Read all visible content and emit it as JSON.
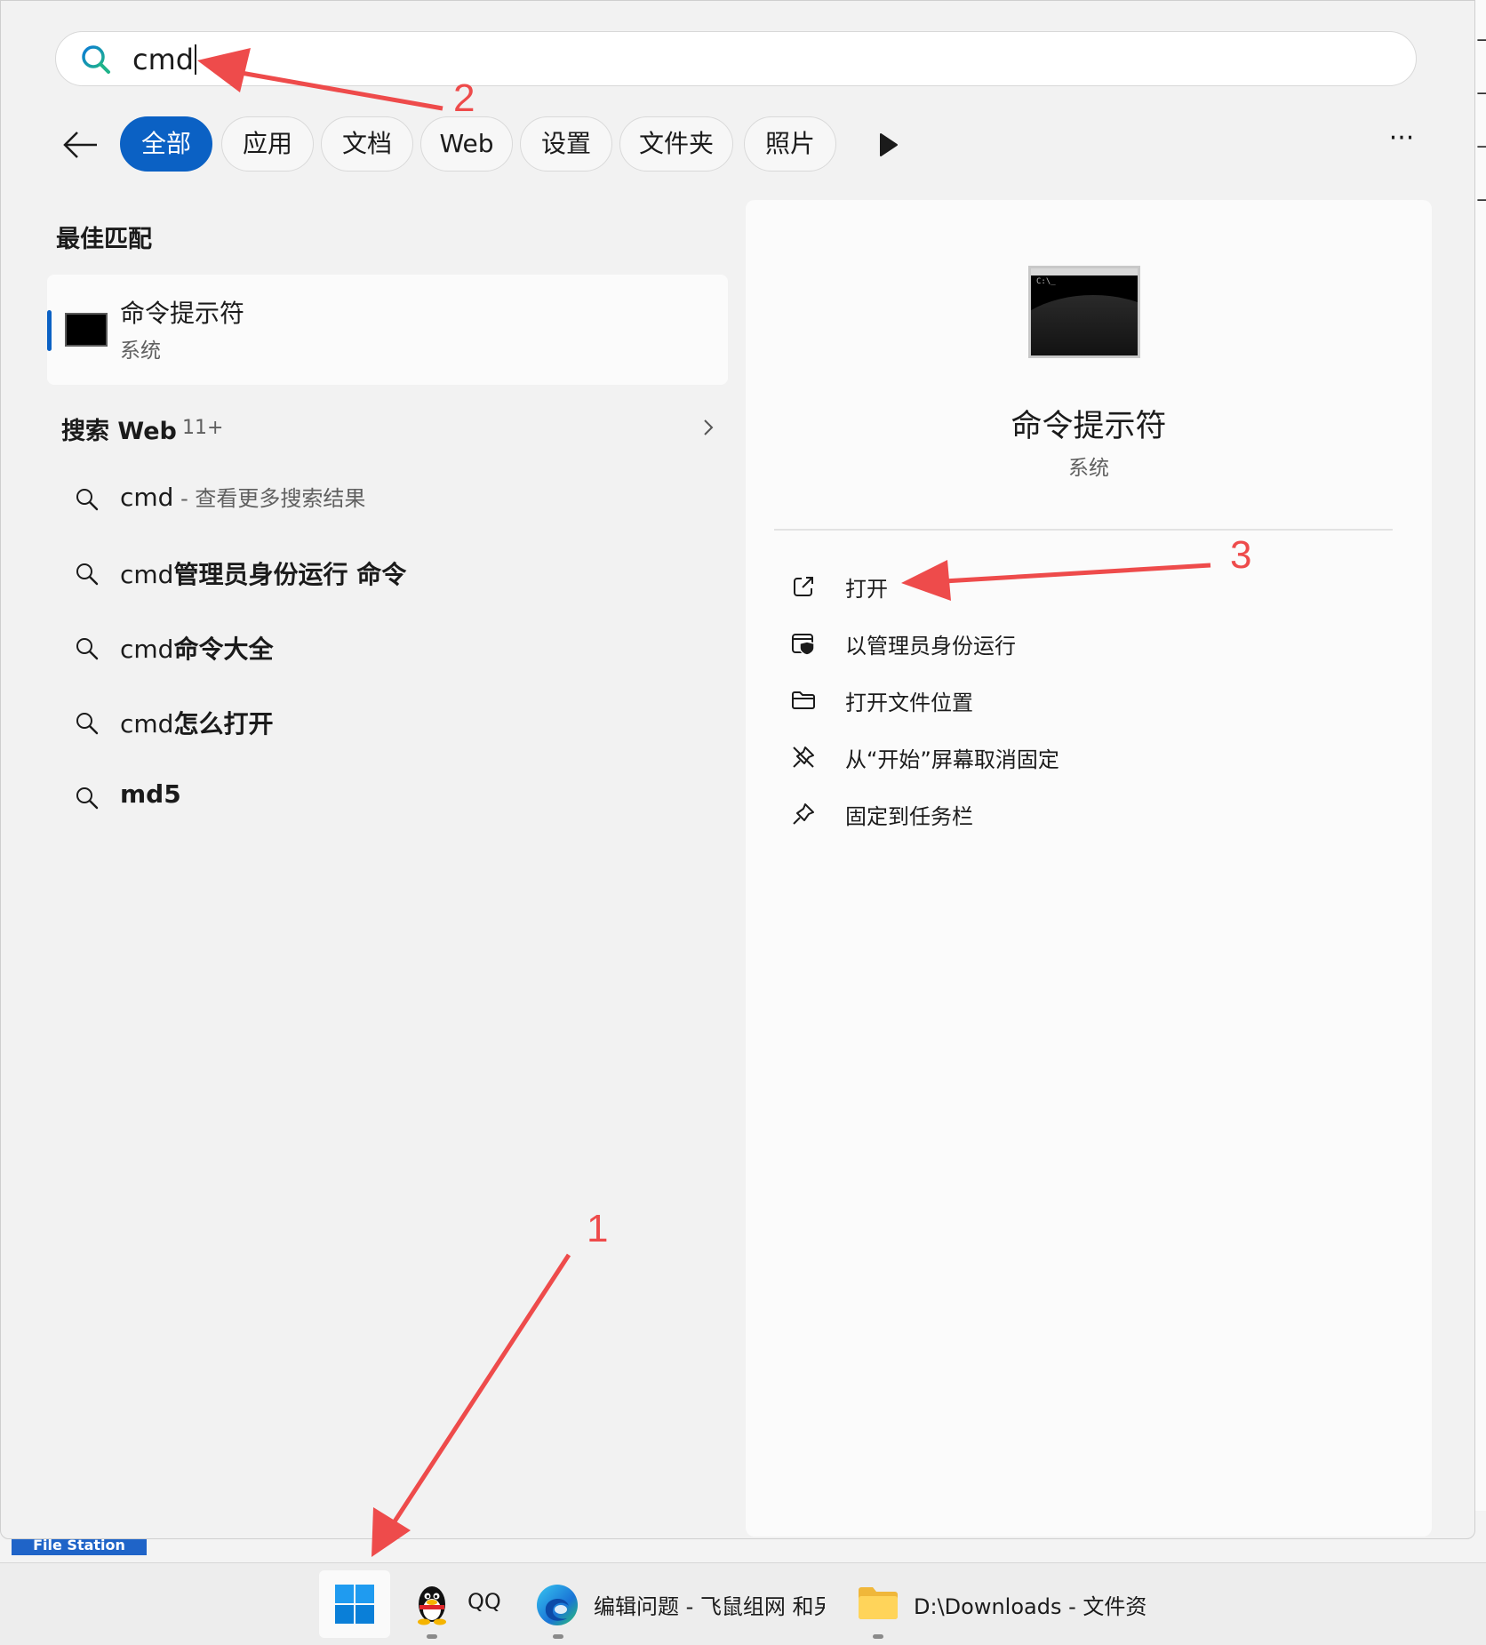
{
  "search": {
    "query": "cmd"
  },
  "filters": {
    "back_label": "←",
    "chips": [
      "全部",
      "应用",
      "文档",
      "Web",
      "设置",
      "文件夹",
      "照片"
    ],
    "active_chip": "全部",
    "more_label": "···"
  },
  "best_match": {
    "heading": "最佳匹配",
    "name": "命令提示符",
    "type": "系统"
  },
  "web": {
    "heading": "搜索 Web",
    "count": "11+",
    "suggestions": [
      {
        "prefix": "cmd",
        "bold": "",
        "hint": " - 查看更多搜索结果"
      },
      {
        "prefix": "cmd",
        "bold": "管理员身份运行 命令",
        "hint": ""
      },
      {
        "prefix": "cmd",
        "bold": "命令大全",
        "hint": ""
      },
      {
        "prefix": "cmd",
        "bold": "怎么打开",
        "hint": ""
      },
      {
        "prefix": "",
        "bold": "md5",
        "hint": ""
      }
    ]
  },
  "preview": {
    "name": "命令提示符",
    "type": "系统",
    "actions": [
      {
        "label": "打开",
        "icon": "open-external-icon"
      },
      {
        "label": "以管理员身份运行",
        "icon": "shield-admin-icon"
      },
      {
        "label": "打开文件位置",
        "icon": "folder-icon"
      },
      {
        "label": "从“开始”屏幕取消固定",
        "icon": "unpin-icon"
      },
      {
        "label": "固定到任务栏",
        "icon": "pin-icon"
      }
    ]
  },
  "annotations": {
    "step1": "1",
    "step2": "2",
    "step3": "3",
    "color": "#ee4b4b"
  },
  "background": {
    "file_station": "File Station"
  },
  "taskbar": {
    "items": [
      {
        "label": "",
        "icon": "windows-start-icon"
      },
      {
        "label": "QQ",
        "icon": "qq-penguin-icon"
      },
      {
        "label": "编辑问题 - 飞鼠组网 和另",
        "icon": "edge-browser-icon"
      },
      {
        "label": "D:\\Downloads - 文件资源",
        "icon": "file-explorer-icon"
      }
    ]
  },
  "colors": {
    "accent": "#0b61c4",
    "panel": "#f2f2f2",
    "preview": "#fbfbfb",
    "annotation": "#ee4b4b"
  }
}
